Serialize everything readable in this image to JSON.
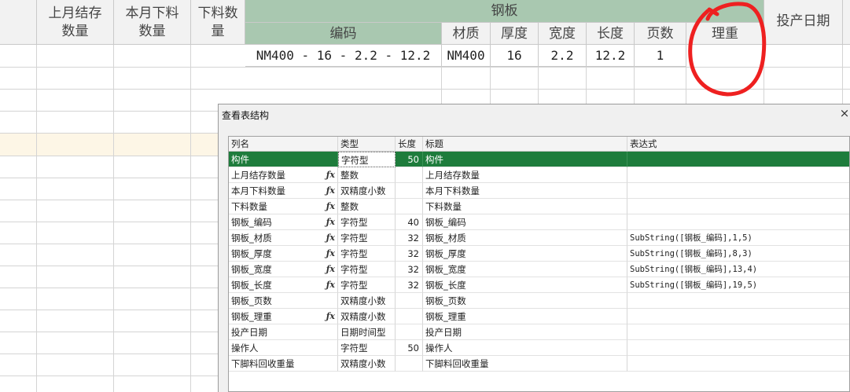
{
  "sheet": {
    "headers": {
      "col_last_month_stock": "上月结存\n数量",
      "col_this_month_cut": "本月下料\n数量",
      "col_cut_qty": "下料数\n量",
      "group_steel_plate": "钢板",
      "sub_code": "编码",
      "sub_material": "材质",
      "sub_thickness": "厚度",
      "sub_width": "宽度",
      "sub_length": "长度",
      "sub_pages": "页数",
      "sub_theoretical_weight": "理重",
      "col_production_date": "投产日期"
    },
    "row1": {
      "code": "NM400 - 16 - 2.2 - 12.2",
      "material": "NM400",
      "thickness": "16",
      "width": "2.2",
      "length": "12.2",
      "pages": "1"
    },
    "annotation_color": "#ee2020"
  },
  "dialog": {
    "title": "查看表结构",
    "close_glyph": "×",
    "columns": {
      "name": "列名",
      "type": "类型",
      "length": "长度",
      "caption": "标题",
      "expression": "表达式"
    },
    "rows": [
      {
        "name": "构件",
        "fx": "",
        "type": "字符型",
        "length": "50",
        "caption": "构件",
        "expr": ""
      },
      {
        "name": "上月结存数量",
        "fx": "ƒx",
        "type": "整数",
        "length": "",
        "caption": "上月结存数量",
        "expr": ""
      },
      {
        "name": "本月下料数量",
        "fx": "ƒx",
        "type": "双精度小数",
        "length": "",
        "caption": "本月下料数量",
        "expr": ""
      },
      {
        "name": "下料数量",
        "fx": "ƒx",
        "type": "整数",
        "length": "",
        "caption": "下料数量",
        "expr": ""
      },
      {
        "name": "钢板_编码",
        "fx": "ƒx",
        "type": "字符型",
        "length": "40",
        "caption": "钢板_编码",
        "expr": ""
      },
      {
        "name": "钢板_材质",
        "fx": "ƒx",
        "type": "字符型",
        "length": "32",
        "caption": "钢板_材质",
        "expr": "SubString([钢板_编码],1,5)"
      },
      {
        "name": "钢板_厚度",
        "fx": "ƒx",
        "type": "字符型",
        "length": "32",
        "caption": "钢板_厚度",
        "expr": "SubString([钢板_编码],8,3)"
      },
      {
        "name": "钢板_宽度",
        "fx": "ƒx",
        "type": "字符型",
        "length": "32",
        "caption": "钢板_宽度",
        "expr": "SubString([钢板_编码],13,4)"
      },
      {
        "name": "钢板_长度",
        "fx": "ƒx",
        "type": "字符型",
        "length": "32",
        "caption": "钢板_长度",
        "expr": "SubString([钢板_编码],19,5)"
      },
      {
        "name": "钢板_页数",
        "fx": "",
        "type": "双精度小数",
        "length": "",
        "caption": "钢板_页数",
        "expr": ""
      },
      {
        "name": "钢板_理重",
        "fx": "ƒx",
        "type": "双精度小数",
        "length": "",
        "caption": "钢板_理重",
        "expr": ""
      },
      {
        "name": "投产日期",
        "fx": "",
        "type": "日期时间型",
        "length": "",
        "caption": "投产日期",
        "expr": ""
      },
      {
        "name": "操作人",
        "fx": "",
        "type": "字符型",
        "length": "50",
        "caption": "操作人",
        "expr": ""
      },
      {
        "name": "下脚料回收重量",
        "fx": "",
        "type": "双精度小数",
        "length": "",
        "caption": "下脚料回收重量",
        "expr": ""
      }
    ],
    "selected_row_color": "#1e7c3c"
  }
}
